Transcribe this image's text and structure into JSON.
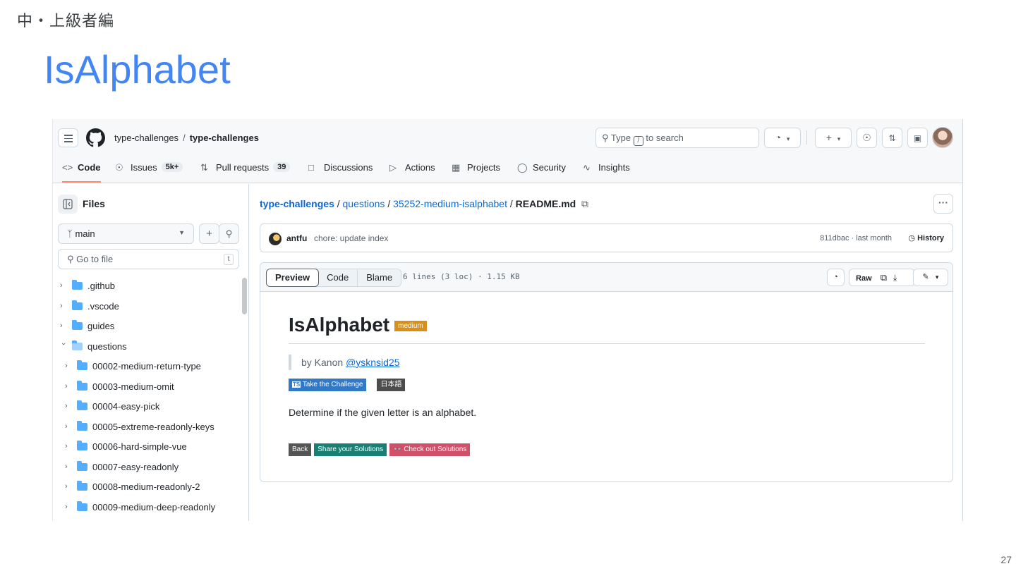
{
  "slide": {
    "section": "中・上級者編",
    "title": "IsAlphabet",
    "page": "27"
  },
  "header": {
    "owner": "type-challenges",
    "separator": "/",
    "repo": "type-challenges",
    "search_pre": "Type",
    "search_key": "/",
    "search_post": "to search",
    "new_label": "+"
  },
  "tabs": [
    {
      "label": "Code",
      "icon": "code-icon"
    },
    {
      "label": "Issues",
      "count": "5k+",
      "icon": "issue-icon"
    },
    {
      "label": "Pull requests",
      "count": "39",
      "icon": "pull-request-icon"
    },
    {
      "label": "Discussions",
      "icon": "discussions-icon"
    },
    {
      "label": "Actions",
      "icon": "play-icon"
    },
    {
      "label": "Projects",
      "icon": "table-icon"
    },
    {
      "label": "Security",
      "icon": "shield-icon"
    },
    {
      "label": "Insights",
      "icon": "graph-icon"
    }
  ],
  "sidebar": {
    "title": "Files",
    "branch": "main",
    "goto_placeholder": "Go to file",
    "goto_key": "t",
    "tree": [
      {
        "name": ".github",
        "level": 0,
        "open": false
      },
      {
        "name": ".vscode",
        "level": 0,
        "open": false
      },
      {
        "name": "guides",
        "level": 0,
        "open": false
      },
      {
        "name": "questions",
        "level": 0,
        "open": true
      },
      {
        "name": "00002-medium-return-type",
        "level": 1,
        "open": false
      },
      {
        "name": "00003-medium-omit",
        "level": 1,
        "open": false
      },
      {
        "name": "00004-easy-pick",
        "level": 1,
        "open": false
      },
      {
        "name": "00005-extreme-readonly-keys",
        "level": 1,
        "open": false
      },
      {
        "name": "00006-hard-simple-vue",
        "level": 1,
        "open": false
      },
      {
        "name": "00007-easy-readonly",
        "level": 1,
        "open": false
      },
      {
        "name": "00008-medium-readonly-2",
        "level": 1,
        "open": false
      },
      {
        "name": "00009-medium-deep-readonly",
        "level": 1,
        "open": false
      }
    ]
  },
  "breadcrumb": {
    "root": "type-challenges",
    "part1": "questions",
    "part2": "35252-medium-isalphabet",
    "file": "README.md",
    "sep": "/"
  },
  "commit": {
    "user": "antfu",
    "message": "chore: update index",
    "meta": "811dbac · last month",
    "history": "History"
  },
  "file_toolbar": {
    "preview": "Preview",
    "code": "Code",
    "blame": "Blame",
    "meta": "6 lines (3 loc) · 1.15 KB",
    "raw": "Raw"
  },
  "readme": {
    "title": "IsAlphabet",
    "difficulty": "medium",
    "by": "by Kanon",
    "author": "@ysknsid25",
    "badge_challenge_icon": "TS",
    "badge_challenge": "Take the Challenge",
    "badge_lang": "日本語",
    "description": "Determine if the given letter is an alphabet.",
    "back": "Back",
    "share": "Share your Solutions",
    "check": "Check out Solutions",
    "check_icon": "👓"
  },
  "colors": {
    "accent": "#4285f4",
    "link": "#0969da",
    "medium": "#d9901a",
    "share": "#1a7f73",
    "check": "#d0506a"
  }
}
